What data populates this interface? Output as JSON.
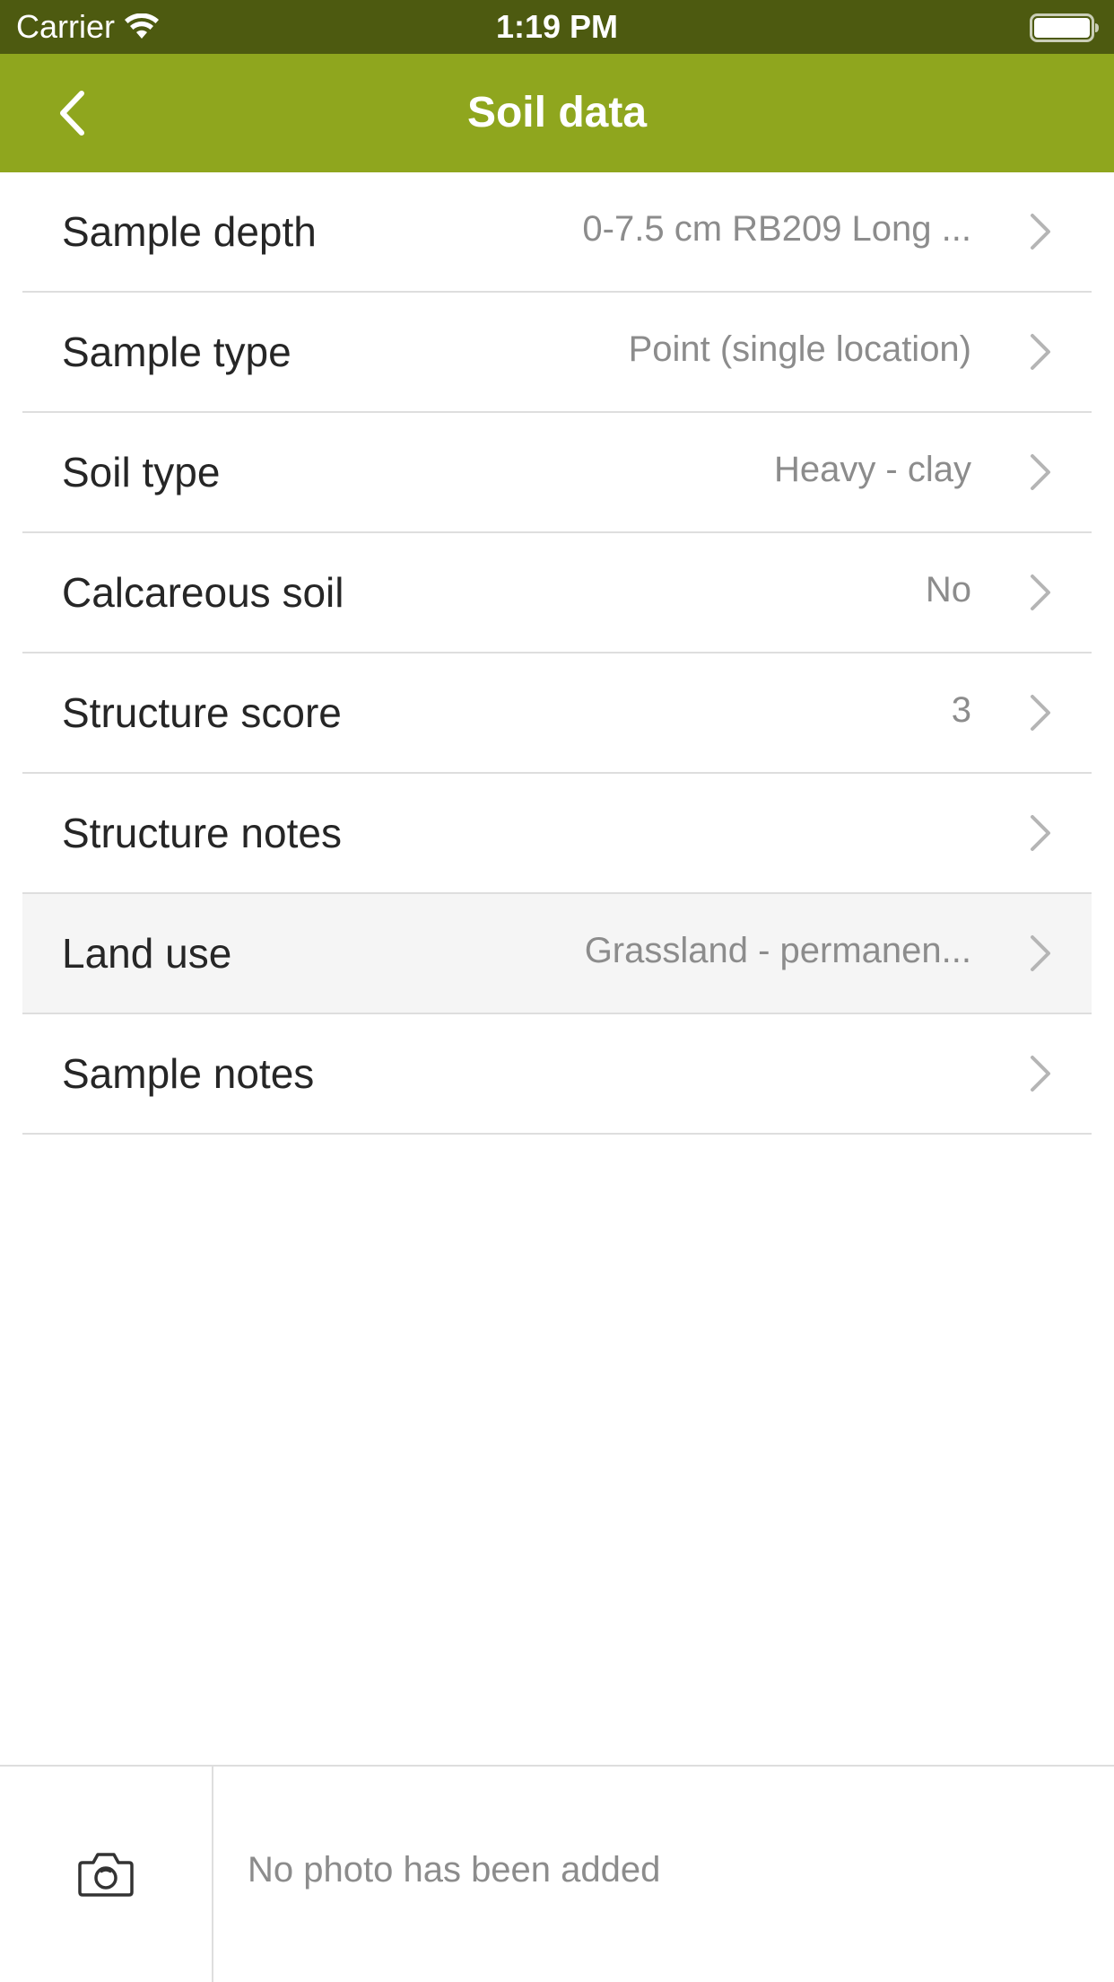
{
  "status_bar": {
    "carrier": "Carrier",
    "time": "1:19 PM"
  },
  "nav": {
    "title": "Soil data",
    "bar_color": "#8fa61e",
    "status_color": "#4d5a10"
  },
  "rows": [
    {
      "label": "Sample depth",
      "value": "0-7.5 cm RB209 Long ..."
    },
    {
      "label": "Sample type",
      "value": "Point (single location)"
    },
    {
      "label": "Soil type",
      "value": "Heavy - clay"
    },
    {
      "label": "Calcareous soil",
      "value": "No"
    },
    {
      "label": "Structure score",
      "value": "3"
    },
    {
      "label": "Structure notes",
      "value": ""
    },
    {
      "label": "Land use",
      "value": "Grassland - permanen..."
    },
    {
      "label": "Sample notes",
      "value": ""
    }
  ],
  "footer": {
    "no_photo_text": "No photo has been added",
    "camera_icon": "camera-icon"
  }
}
